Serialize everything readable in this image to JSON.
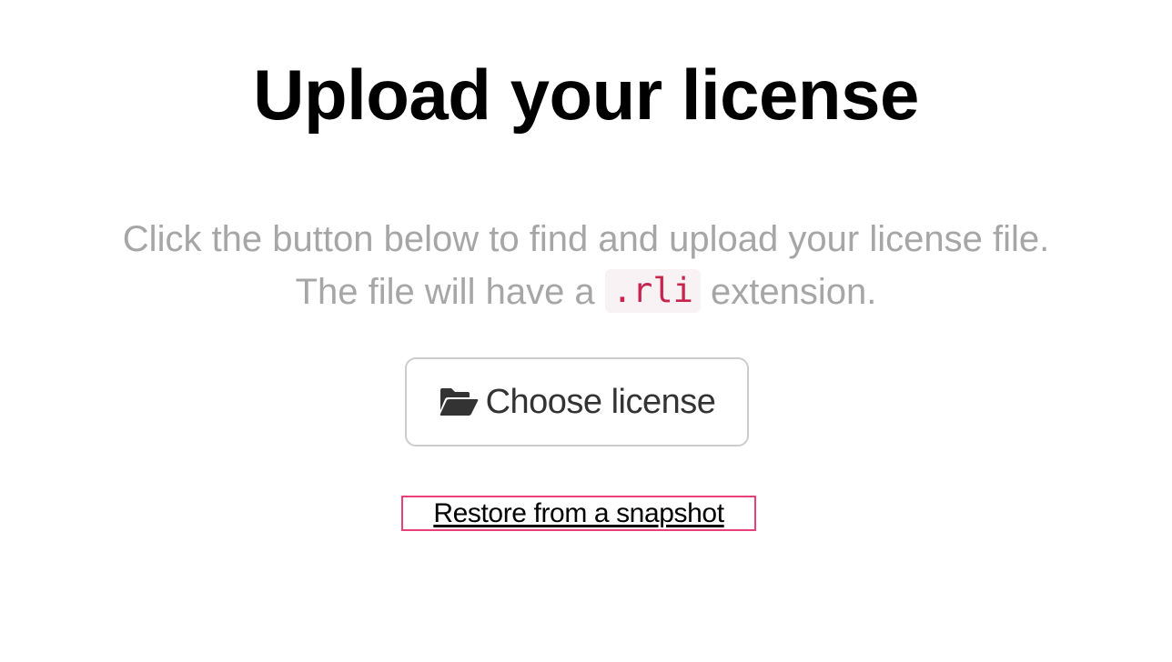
{
  "page": {
    "title": "Upload your license",
    "description": {
      "line1": "Click the button below to find and upload your license file.",
      "line2_prefix": "The file will have a ",
      "extension": ".rli",
      "line2_suffix": " extension."
    }
  },
  "actions": {
    "choose_button": {
      "icon": "folder-open-icon",
      "label": "Choose license"
    },
    "snapshot_link": {
      "label": "Restore from a snapshot"
    }
  },
  "colors": {
    "title": "#000000",
    "description": "#a6a6a6",
    "code_text": "#c7254e",
    "code_background": "#f9f2f4",
    "button_border": "#cccccc",
    "button_text": "#333333",
    "highlight_border": "#e8407a"
  }
}
